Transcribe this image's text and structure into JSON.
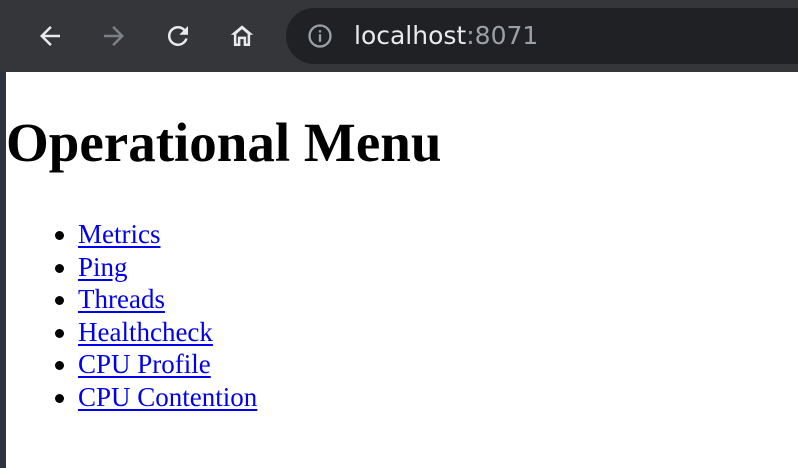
{
  "browser": {
    "toolbar_color": "#35363a",
    "omnibox_color": "#202124",
    "nav_icons": [
      "back-arrow-icon",
      "forward-arrow-icon",
      "reload-icon",
      "home-icon"
    ],
    "site_info_icon": "info-circle-icon",
    "url_host": "localhost",
    "url_port": ":8071"
  },
  "page": {
    "title": "Operational Menu",
    "link_color": "#0000ee",
    "links": [
      {
        "label": "Metrics"
      },
      {
        "label": "Ping"
      },
      {
        "label": "Threads"
      },
      {
        "label": "Healthcheck"
      },
      {
        "label": "CPU Profile"
      },
      {
        "label": "CPU Contention"
      }
    ]
  }
}
